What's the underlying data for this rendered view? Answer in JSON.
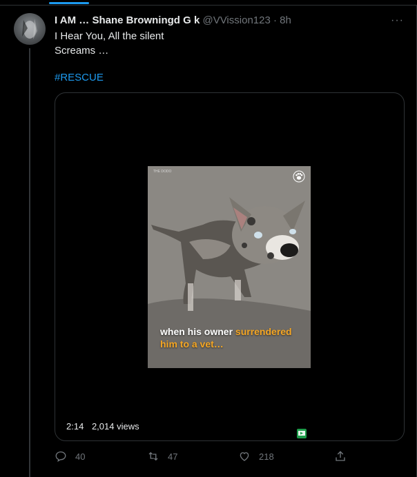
{
  "tweet": {
    "display_name": "I AM … Shane Browningd G k",
    "handle": "@VVission123",
    "dot": "·",
    "time": "8h",
    "more": "···",
    "text_line1": "I Hear You, All the silent",
    "text_line2": "Screams …",
    "hashtag": "#RESCUE"
  },
  "video": {
    "caption_a": "when his owner ",
    "caption_b": "surrendered",
    "caption_c": "him to a vet…",
    "watermark": "THE DODO",
    "duration": "2:14",
    "views": "2,014 views",
    "caption_highlight_color": "#f5a623"
  },
  "actions": {
    "reply_count": "40",
    "retweet_count": "47",
    "like_count": "218"
  },
  "colors": {
    "background": "#000000",
    "text": "#e7e9ea",
    "muted": "#71767b",
    "accent": "#1d9bf0",
    "border": "#2f3336"
  }
}
